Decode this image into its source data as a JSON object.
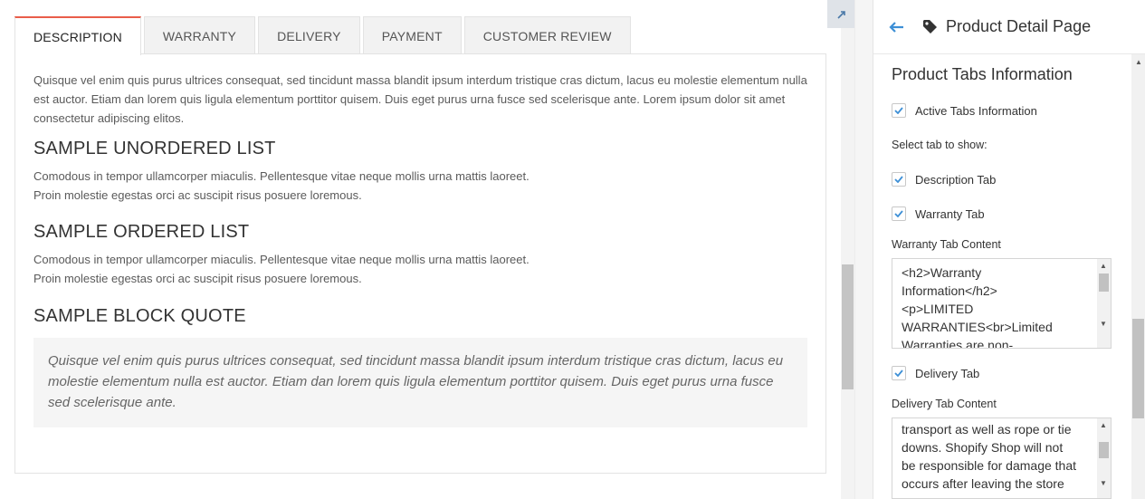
{
  "tabs": [
    "DESCRIPTION",
    "WARRANTY",
    "DELIVERY",
    "PAYMENT",
    "CUSTOMER REVIEW"
  ],
  "content": {
    "intro": "Quisque vel enim quis purus ultrices consequat, sed tincidunt massa blandit ipsum interdum tristique cras dictum, lacus eu molestie elementum nulla est auctor. Etiam dan lorem quis ligula elementum porttitor quisem. Duis eget purus urna fusce sed scelerisque ante. Lorem ipsum dolor sit amet consectetur adipiscing elitos.",
    "h_unordered": "SAMPLE UNORDERED LIST",
    "unordered_line1": "Comodous in tempor ullamcorper miaculis. Pellentesque vitae neque mollis urna mattis laoreet.",
    "unordered_line2": "Proin molestie egestas orci ac suscipit risus posuere loremous.",
    "h_ordered": "SAMPLE ORDERED LIST",
    "ordered_line1": "Comodous in tempor ullamcorper miaculis. Pellentesque vitae neque mollis urna mattis laoreet.",
    "ordered_line2": "Proin molestie egestas orci ac suscipit risus posuere loremous.",
    "h_quote": "SAMPLE BLOCK QUOTE",
    "quote": "Quisque vel enim quis purus ultrices consequat, sed tincidunt massa blandit ipsum interdum tristique cras dictum, lacus eu molestie elementum nulla est auctor. Etiam dan lorem quis ligula elementum porttitor quisem. Duis eget purus urna fusce sed scelerisque ante."
  },
  "sidebar": {
    "title": "Product Detail Page",
    "section_title": "Product Tabs Information",
    "active_tabs_label": "Active Tabs Information",
    "select_tab_label": "Select tab to show:",
    "description_tab_label": "Description Tab",
    "warranty_tab_label": "Warranty Tab",
    "warranty_content_label": "Warranty Tab Content",
    "warranty_content_value": "<h2>Warranty\nInformation</h2>\n<p>LIMITED\nWARRANTIES<br>Limited\nWarranties are non-",
    "delivery_tab_label": "Delivery Tab",
    "delivery_content_label": "Delivery Tab Content",
    "delivery_content_value": "transport as well as rope or tie\ndowns. Shopify Shop will not\nbe responsible for damage that\noccurs after leaving the store"
  },
  "colors": {
    "accent_tab": "#e95d4a",
    "check": "#3d8fd6",
    "back_arrow": "#3d8fd6"
  },
  "icons": [
    "back-arrow-icon",
    "tag-icon",
    "expand-icon",
    "checkmark-icon"
  ]
}
